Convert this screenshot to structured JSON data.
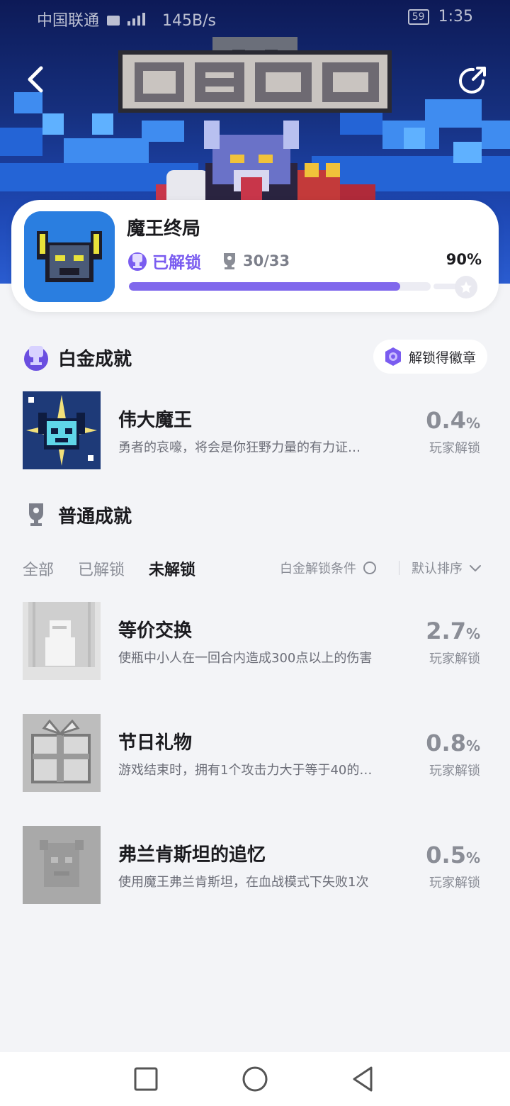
{
  "status_bar": {
    "carrier": "中国联通",
    "speed": "145B/s",
    "battery": "59",
    "time": "1:35"
  },
  "hero": {
    "title": "魔王终局"
  },
  "game": {
    "name": "魔王终局",
    "unlock_status": "已解锁",
    "trophies": "30/33",
    "percent_label": "90%",
    "progress_fraction": 0.9
  },
  "platinum": {
    "heading": "白金成就",
    "badge_button": "解锁得徽章",
    "item": {
      "name": "伟大魔王",
      "desc": "勇者的哀嚎，将会是你狂野力量的有力证…",
      "rate": "0.4",
      "rate_unit": "%",
      "rate_label": "玩家解锁"
    }
  },
  "normal": {
    "heading": "普通成就",
    "tabs": [
      "全部",
      "已解锁",
      "未解锁"
    ],
    "active_tab": "未解锁",
    "filter_label": "白金解锁条件",
    "sort_label": "默认排序",
    "items": [
      {
        "name": "等价交换",
        "desc": "使瓶中小人在一回合内造成300点以上的伤害",
        "rate": "2.7",
        "rate_unit": "%",
        "rate_label": "玩家解锁"
      },
      {
        "name": "节日礼物",
        "desc": "游戏结束时，拥有1个攻击力大于等于40的…",
        "rate": "0.8",
        "rate_unit": "%",
        "rate_label": "玩家解锁"
      },
      {
        "name": "弗兰肯斯坦的追忆",
        "desc": "使用魔王弗兰肯斯坦，在血战模式下失败1次",
        "rate": "0.5",
        "rate_unit": "%",
        "rate_label": "玩家解锁"
      }
    ]
  },
  "colors": {
    "accent": "#7a5cf0",
    "progress": "#8068ec",
    "hero_bg": "#16307f"
  }
}
